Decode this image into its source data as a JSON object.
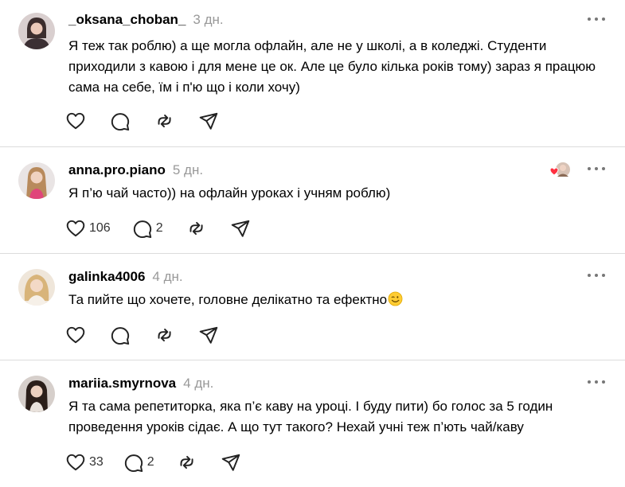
{
  "posts": [
    {
      "username": "_oksana_choban_",
      "time": "3 дн.",
      "text": "Я теж так роблю) а ще могла офлайн, але не у школі, а в коледжі. Студенти приходили з кавою і для мене це ок. Але це було кілька років тому) зараз я працюю сама на себе, їм і п'ю що і коли хочу)",
      "likes": "",
      "replies": ""
    },
    {
      "username": "anna.pro.piano",
      "time": "5 дн.",
      "text": "Я п’ю чай часто)) на офлайн уроках і учням роблю)",
      "likes": "106",
      "replies": "2"
    },
    {
      "username": "galinka4006",
      "time": "4 дн.",
      "text": "Та пийте що хочете, головне делікатно та ефектно",
      "likes": "",
      "replies": ""
    },
    {
      "username": "mariia.smyrnova",
      "time": "4 дн.",
      "text": "Я та сама репетиторка, яка п’є каву на уроці. І буду пити) бо голос за 5 годин проведення уроків сідає. А що тут такого? Нехай учні теж п’ють чай/каву",
      "likes": "33",
      "replies": "2"
    }
  ],
  "icons": {
    "like": "heart-icon",
    "reply": "comment-icon",
    "repost": "repost-icon",
    "share": "share-icon",
    "more": "more-icon",
    "emoji": "winking-face-emoji"
  },
  "colors": {
    "text": "#000000",
    "muted": "#999999",
    "divider": "#dcdcdc",
    "icon": "#222222",
    "heart_red": "#ff3040"
  }
}
